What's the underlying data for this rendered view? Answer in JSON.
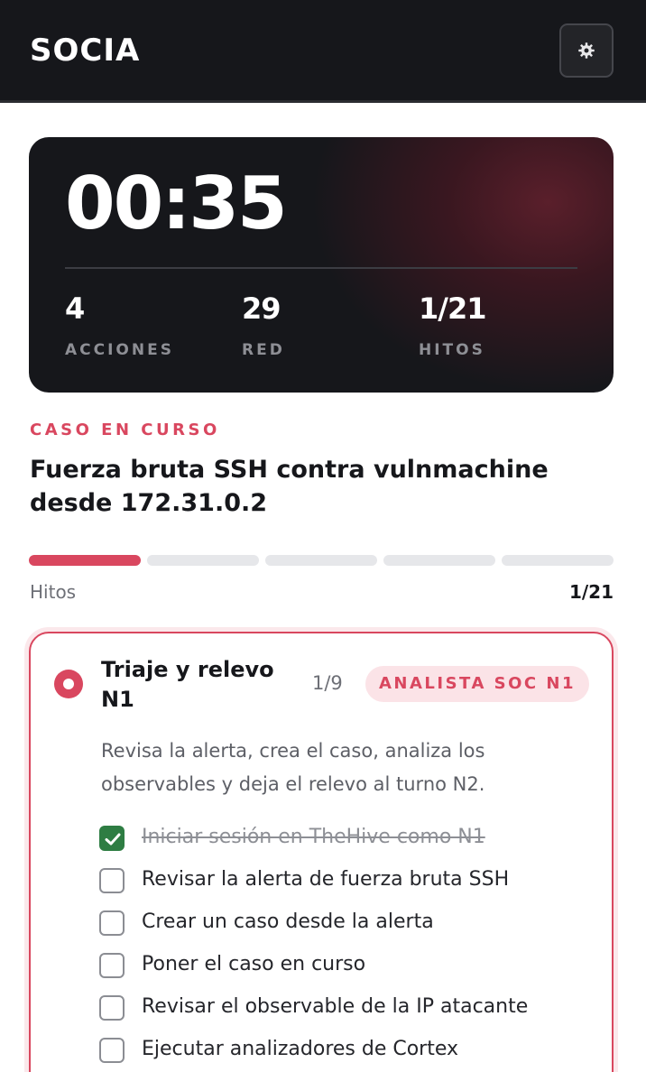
{
  "header": {
    "brand": "SOCIA",
    "settings_icon": "gear-icon"
  },
  "timer_card": {
    "time": "00:35",
    "stats": [
      {
        "value": "4",
        "label": "ACCIONES"
      },
      {
        "value": "29",
        "label": "RED"
      },
      {
        "value": "1/21",
        "label": "HITOS"
      }
    ]
  },
  "case": {
    "kicker": "CASO EN CURSO",
    "title": "Fuerza bruta SSH contra vulnmachine desde 172.31.0.2"
  },
  "progress": {
    "label": "Hitos",
    "count": "1/21",
    "segments_total": 5,
    "segments_filled": 1
  },
  "phase": {
    "title": "Triaje y relevo N1",
    "count": "1/9",
    "role": "ANALISTA SOC N1",
    "description": "Revisa la alerta, crea el caso, analiza los observables y deja el relevo al turno N2.",
    "tasks": [
      {
        "label": "Iniciar sesión en TheHive como N1",
        "done": true
      },
      {
        "label": "Revisar la alerta de fuerza bruta SSH",
        "done": false
      },
      {
        "label": "Crear un caso desde la alerta",
        "done": false
      },
      {
        "label": "Poner el caso en curso",
        "done": false
      },
      {
        "label": "Revisar el observable de la IP atacante",
        "done": false
      },
      {
        "label": "Ejecutar analizadores de Cortex",
        "done": false
      }
    ]
  },
  "colors": {
    "accent": "#d9475f",
    "dark": "#16171b",
    "success": "#2e7d43"
  }
}
